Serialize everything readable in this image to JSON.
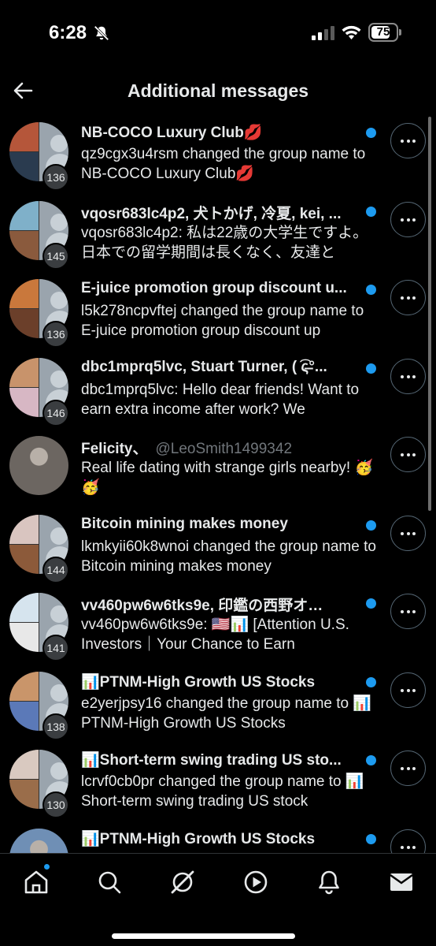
{
  "status_bar": {
    "time": "6:28",
    "battery": "75",
    "battery_level": 0.75,
    "icons": [
      "bell-off-icon",
      "signal-icon",
      "wifi-icon",
      "battery-icon"
    ]
  },
  "header": {
    "title": "Additional messages",
    "back_icon": "arrow-left-icon"
  },
  "messages": [
    {
      "title": "NB-COCO Luxury Club💋",
      "handle": "",
      "text": "qz9cgx3u4rsm changed the group name to NB-COCO Luxury Club💋",
      "count": "136",
      "unread": true,
      "avatar_colors": [
        "#b5563a",
        "#2a3b4f"
      ]
    },
    {
      "title": "vqosr683lc4p2, 犬トかげ, 冷夏, kei, ...",
      "handle": "",
      "text": "vqosr683lc4p2: 私は22歳の大学生ですよ。日本での留学期間は長くなく、友達と",
      "count": "145",
      "unread": true,
      "avatar_colors": [
        "#7fb0c9",
        "#8a5a3d"
      ]
    },
    {
      "title": "E-juice promotion group discount u...",
      "handle": "",
      "text": "l5k278ncpvftej changed the group name to E-juice promotion group discount up",
      "count": "136",
      "unread": true,
      "avatar_colors": [
        "#c9783c",
        "#6b3f2a"
      ]
    },
    {
      "title": "dbc1mprq5lvc, Stuart Turner, ( ͡ς̶°...",
      "handle": "",
      "text": "dbc1mprq5lvc: Hello dear friends! Want to earn extra income after work? We",
      "count": "146",
      "unread": true,
      "avatar_colors": [
        "#c8936b",
        "#d7b7c4"
      ]
    },
    {
      "title": "Felicity、",
      "handle": "@LeoSmith1499342",
      "text": "Real life dating with strange girls nearby! 🥳🥳",
      "count": "",
      "unread": false,
      "avatar_colors": [
        "#6c6661",
        "#6c6661"
      ]
    },
    {
      "title": "Bitcoin mining makes money",
      "handle": "",
      "text": "lkmkyii60k8wnoi changed the group name to Bitcoin mining makes money",
      "count": "144",
      "unread": true,
      "avatar_colors": [
        "#d9c5c0",
        "#8c5a3a"
      ]
    },
    {
      "title": "vv460pw6w6tks9e, 印鑑の西野オ…",
      "handle": "",
      "text": "vv460pw6w6tks9e: 🇺🇸📊 [Attention U.S. Investors｜Your Chance to Earn",
      "count": "141",
      "unread": true,
      "avatar_colors": [
        "#d6e4ee",
        "#e8e8e8"
      ]
    },
    {
      "title": "📊PTNM-High Growth US Stocks",
      "handle": "",
      "text": "e2yerjpsy16 changed the group name to 📊PTNM-High Growth US Stocks",
      "count": "138",
      "unread": true,
      "avatar_colors": [
        "#c9956a",
        "#5b79b8"
      ]
    },
    {
      "title": "📊Short-term swing trading US sto...",
      "handle": "",
      "text": "lcrvf0cb0pr changed the group name to 📊Short-term swing trading US stock",
      "count": "130",
      "unread": true,
      "avatar_colors": [
        "#d9c9c0",
        "#9a6d4a"
      ]
    },
    {
      "title": "📊PTNM-High Growth US Stocks",
      "handle": "",
      "text": "",
      "count": "",
      "unread": true,
      "avatar_colors": [
        "#6f8fb5",
        "#e0e0e0"
      ]
    }
  ],
  "bottom_nav": {
    "items": [
      "home-icon",
      "search-icon",
      "grok-icon",
      "video-icon",
      "notifications-icon",
      "messages-icon"
    ],
    "active": "home-icon"
  },
  "colors": {
    "background": "#000000",
    "accent": "#1d9bf0",
    "text": "#e7e9ea",
    "muted": "#71767b"
  }
}
